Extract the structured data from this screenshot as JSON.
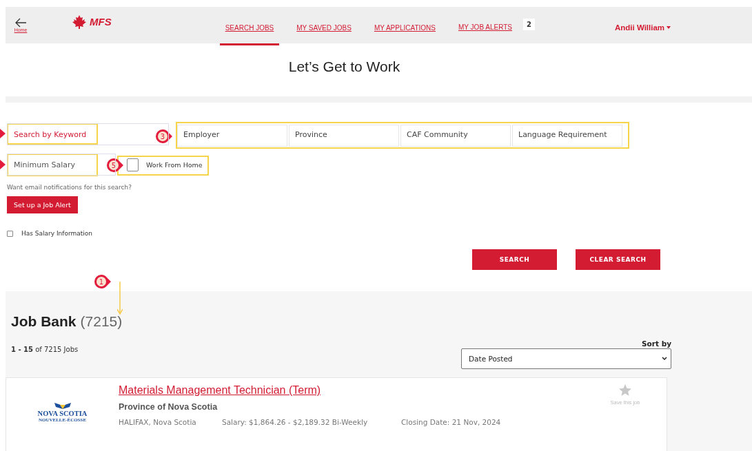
{
  "header": {
    "back_label": "Home",
    "logo": "MFS",
    "nav": [
      {
        "label": "SEARCH JOBS",
        "selected": true
      },
      {
        "label": "MY SAVED JOBS",
        "selected": false
      },
      {
        "label": "MY APPLICATIONS",
        "selected": false
      },
      {
        "label": "MY JOB ALERTS",
        "selected": false,
        "badge": "2"
      }
    ],
    "user": "Andii William"
  },
  "title": "Let’s Get to Work",
  "filters": {
    "keyword": {
      "placeholder": "Search by Keyword"
    },
    "selects": [
      "Employer",
      "Province",
      "CAF Community",
      "Language Requirement"
    ],
    "min_salary": {
      "placeholder": "Minimum Salary"
    },
    "work_from_home": {
      "label": "Work From Home",
      "checked": false
    },
    "alert_prompt": "Want email notifications for this search?",
    "alert_button": "Set up a Job Alert",
    "has_salary": {
      "label": "Has Salary Information",
      "checked": false
    },
    "buttons": [
      "SEARCH",
      "CLEAR SEARCH"
    ]
  },
  "callouts": [
    {
      "label": "3"
    },
    {
      "label": "5"
    },
    {
      "label": "1"
    }
  ],
  "results": {
    "heading": "Job Bank",
    "count": "(7215)",
    "range": "**1 - 15** of 7215 Jobs",
    "sort_label": "Sort by",
    "sort_value": "Date Posted",
    "jobs": [
      {
        "logo_line_1": "NOVA SCOTIA",
        "logo_line_2": "NOUVELLE-ÉCOSSE",
        "title": "Materials Management Technician (Term)",
        "employer": "Province of Nova Scotia",
        "location": "HALIFAX, Nova Scotia",
        "salary": "Salary: $1,864.26 - $2,189.32 Bi-Weekly",
        "closing": "Closing Date: 21 Nov, 2024",
        "save_label": "Save this job",
        "saved": false
      }
    ]
  }
}
